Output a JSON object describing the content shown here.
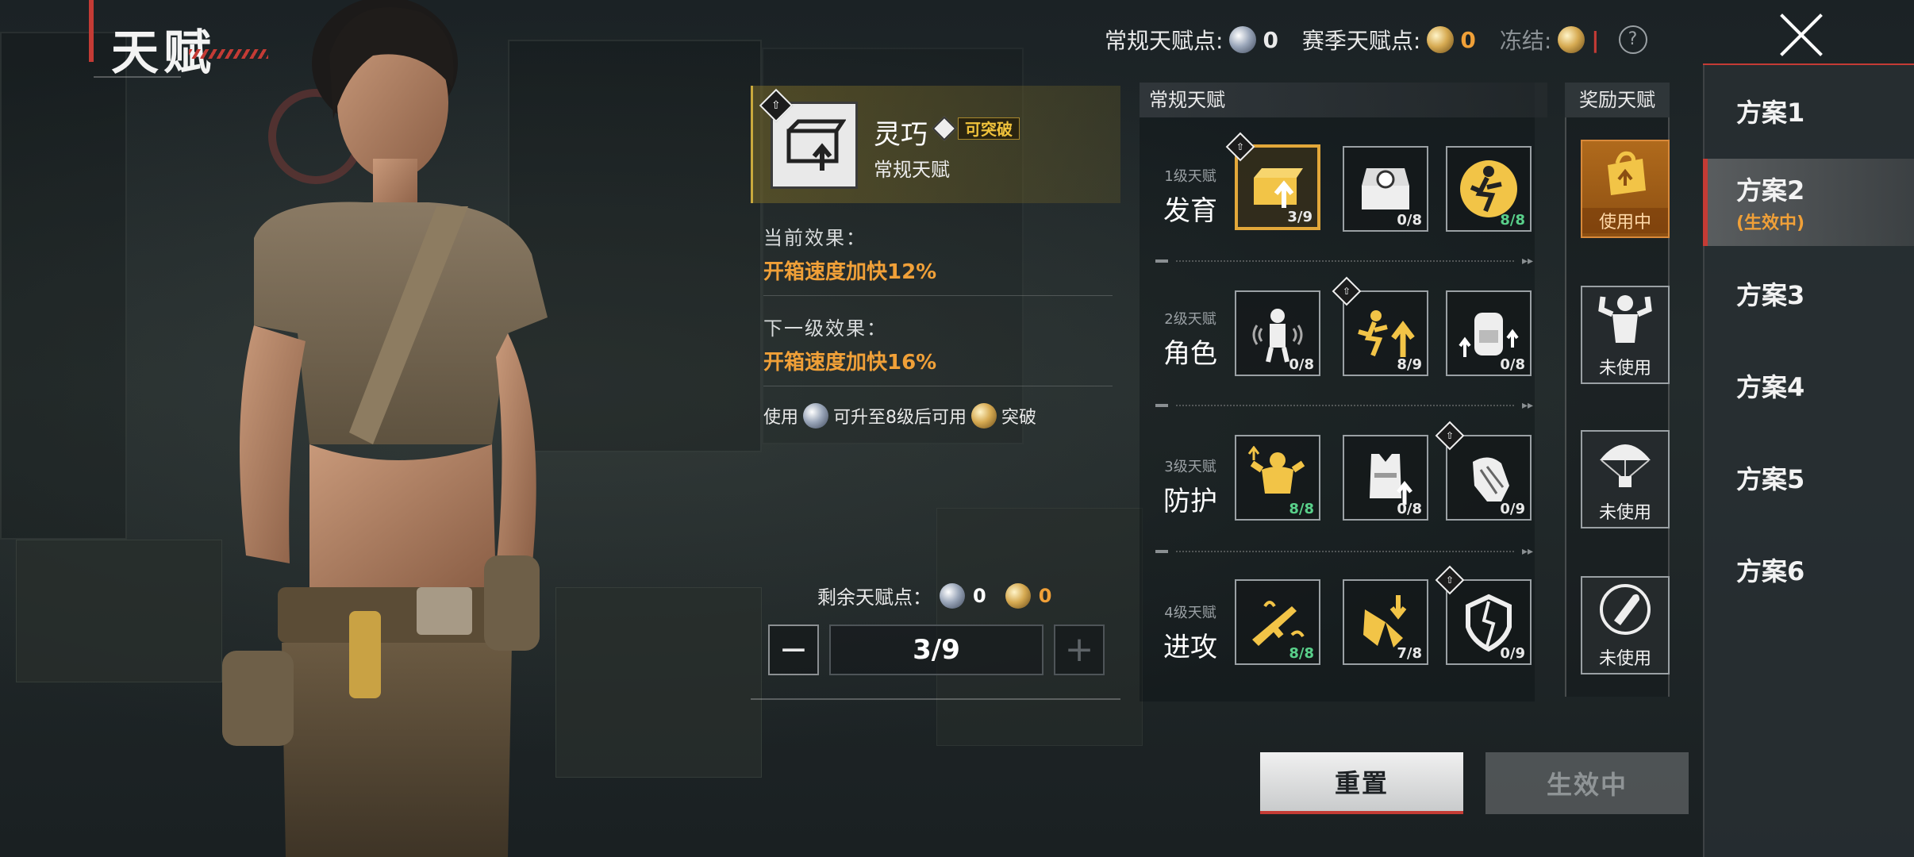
{
  "header": {
    "title": "天赋"
  },
  "points_bar": {
    "regular_label": "常规天赋点:",
    "regular_value": "0",
    "season_label": "赛季天赋点:",
    "season_value": "0",
    "freeze_label": "冻结:",
    "freeze_value": "|"
  },
  "detail": {
    "name": "灵巧",
    "breakthrough_badge": "可突破",
    "type": "常规天赋",
    "current_label": "当前效果：",
    "current_value": "开箱速度加快12%",
    "next_label": "下一级效果：",
    "next_value": "开箱速度加快16%",
    "use_prefix": "使用",
    "use_middle": "可升至8级后可用",
    "use_suffix": "突破",
    "remaining_label": "剩余天赋点：",
    "remaining_silver": "0",
    "remaining_gold": "0",
    "level_value": "3/9",
    "minus_label": "−",
    "plus_label": "+"
  },
  "grid": {
    "title": "常规天赋",
    "bonus_title": "奖励天赋",
    "tiers": [
      {
        "small": "1级天赋",
        "big": "发育",
        "nodes": [
          {
            "icon": "lockbox-upgrade-icon",
            "count": "3/9",
            "max": false,
            "selected": true,
            "breakable": true
          },
          {
            "icon": "crate-open-icon",
            "count": "0/8",
            "max": false,
            "selected": false,
            "breakable": false
          },
          {
            "icon": "runner-coin-icon",
            "count": "8/8",
            "max": true,
            "selected": false,
            "breakable": false
          }
        ]
      },
      {
        "small": "2级天赋",
        "big": "角色",
        "nodes": [
          {
            "icon": "sound-soldier-icon",
            "count": "0/8",
            "max": false,
            "selected": false,
            "breakable": false
          },
          {
            "icon": "sprint-up-icon",
            "count": "8/9",
            "max": false,
            "selected": false,
            "breakable": true
          },
          {
            "icon": "backpack-up-icon",
            "count": "0/8",
            "max": false,
            "selected": false,
            "breakable": false
          }
        ]
      },
      {
        "small": "3级天赋",
        "big": "防护",
        "nodes": [
          {
            "icon": "muscle-up-icon",
            "count": "8/8",
            "max": true,
            "selected": false,
            "breakable": false
          },
          {
            "icon": "vest-up-icon",
            "count": "0/8",
            "max": false,
            "selected": false,
            "breakable": false
          },
          {
            "icon": "glove-icon",
            "count": "0/9",
            "max": false,
            "selected": false,
            "breakable": true
          }
        ]
      },
      {
        "small": "4级天赋",
        "big": "进攻",
        "nodes": [
          {
            "icon": "rifle-up-icon",
            "count": "8/8",
            "max": true,
            "selected": false,
            "breakable": false
          },
          {
            "icon": "bullet-hit-icon",
            "count": "7/8",
            "max": false,
            "selected": false,
            "breakable": false
          },
          {
            "icon": "armor-break-icon",
            "count": "0/9",
            "max": false,
            "selected": false,
            "breakable": true
          }
        ]
      }
    ],
    "bonus": [
      {
        "icon": "supply-bag-icon",
        "state": "使用中",
        "active": true
      },
      {
        "icon": "flex-soldier-icon",
        "state": "未使用",
        "active": false
      },
      {
        "icon": "parachute-icon",
        "state": "未使用",
        "active": false
      },
      {
        "icon": "shell-icon",
        "state": "未使用",
        "active": false
      }
    ]
  },
  "plans": [
    {
      "label": "方案1",
      "tag": "",
      "selected": false
    },
    {
      "label": "方案2",
      "tag": "(生效中)",
      "selected": true
    },
    {
      "label": "方案3",
      "tag": "",
      "selected": false
    },
    {
      "label": "方案4",
      "tag": "",
      "selected": false
    },
    {
      "label": "方案5",
      "tag": "",
      "selected": false
    },
    {
      "label": "方案6",
      "tag": "",
      "selected": false
    }
  ],
  "actions": {
    "reset": "重置",
    "active": "生效中"
  },
  "colors": {
    "accent_red": "#c43b35",
    "gold": "#f0a038",
    "max_green": "#59d08a",
    "selected_border": "#e3a83a"
  }
}
